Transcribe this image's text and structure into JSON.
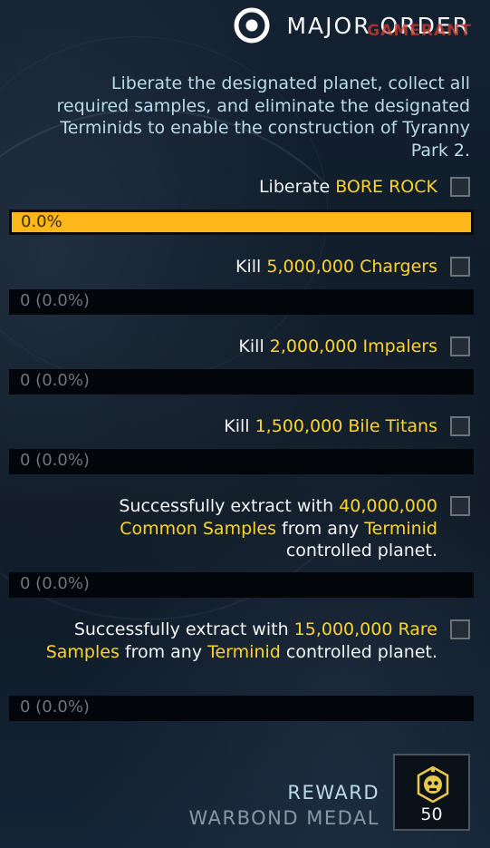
{
  "header": {
    "title": "MAJOR ORDER",
    "icon": "target-icon",
    "watermark": "GAMERANT"
  },
  "description": "Liberate the designated planet, collect all required samples, and eliminate the designated Terminids to enable the construction of Tyranny Park 2.",
  "objectives": [
    {
      "parts": [
        "Liberate ",
        "BORE ROCK"
      ],
      "progress_text": "0.0%",
      "progress": 1.0,
      "completed": false
    },
    {
      "parts": [
        "Kill ",
        "5,000,000 Chargers"
      ],
      "progress_text": "0 (0.0%)",
      "progress": 0.0,
      "completed": false
    },
    {
      "parts": [
        "Kill ",
        "2,000,000 Impalers"
      ],
      "progress_text": "0 (0.0%)",
      "progress": 0.0,
      "completed": false
    },
    {
      "parts": [
        "Kill ",
        "1,500,000 Bile Titans"
      ],
      "progress_text": "0 (0.0%)",
      "progress": 0.0,
      "completed": false
    },
    {
      "parts": [
        "Successfully extract with ",
        "40,000,000 Common Samples",
        " from any ",
        "Terminid",
        " controlled planet."
      ],
      "progress_text": "0 (0.0%)",
      "progress": 0.0,
      "completed": false
    },
    {
      "parts": [
        "Successfully extract with ",
        "15,000,000 Rare Samples",
        " from any ",
        "Terminid",
        " controlled planet."
      ],
      "progress_text": "0 (0.0%)",
      "progress": 0.0,
      "completed": false
    }
  ],
  "reward": {
    "title": "REWARD",
    "name": "WARBOND MEDAL",
    "amount": "50",
    "icon": "warbond-medal-icon"
  },
  "colors": {
    "highlight": "#fdd42a",
    "progress_fill": "#fdb71a",
    "description": "#b9dbe9"
  }
}
